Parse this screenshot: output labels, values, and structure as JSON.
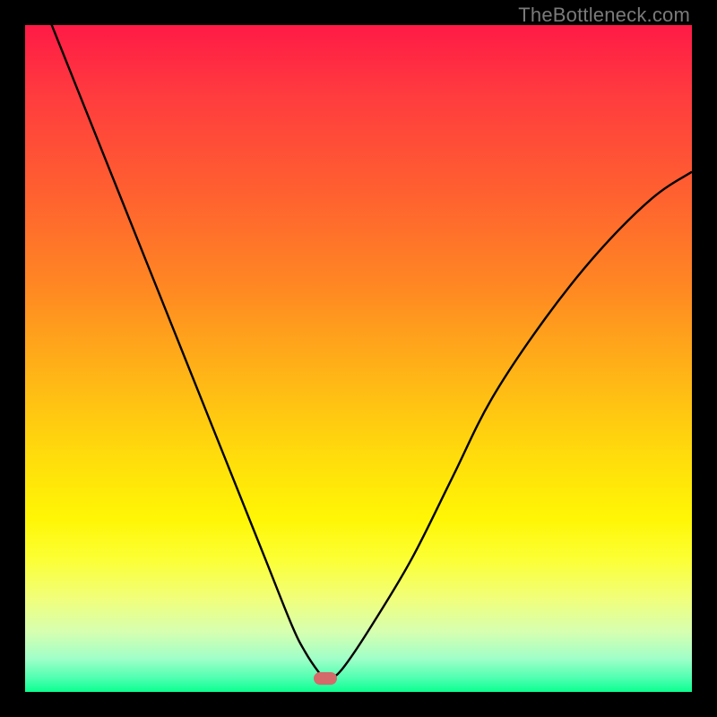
{
  "watermark": "TheBottleneck.com",
  "chart_data": {
    "type": "line",
    "title": "",
    "xlabel": "",
    "ylabel": "",
    "xlim": [
      0,
      100
    ],
    "ylim": [
      0,
      100
    ],
    "grid": false,
    "series": [
      {
        "name": "bottleneck_curve",
        "x": [
          0,
          4,
          8,
          12,
          16,
          20,
          24,
          28,
          32,
          36,
          40,
          42,
          44,
          45,
          46,
          48,
          52,
          58,
          64,
          70,
          78,
          86,
          94,
          100
        ],
        "values": [
          110,
          100,
          90,
          80,
          70,
          60,
          50,
          40,
          30,
          20,
          10,
          6,
          3,
          2,
          2,
          4,
          10,
          20,
          32,
          44,
          56,
          66,
          74,
          78
        ]
      }
    ],
    "annotations": [
      {
        "type": "marker",
        "shape": "pill",
        "x": 45,
        "y": 2,
        "color": "#d46a6a"
      }
    ],
    "background_gradient": {
      "direction": "vertical",
      "stops": [
        {
          "pos": 0.0,
          "color": "#ff1a46"
        },
        {
          "pos": 0.25,
          "color": "#ff6030"
        },
        {
          "pos": 0.52,
          "color": "#ffb317"
        },
        {
          "pos": 0.74,
          "color": "#fff605"
        },
        {
          "pos": 0.91,
          "color": "#d6ffb0"
        },
        {
          "pos": 1.0,
          "color": "#0bff8f"
        }
      ]
    }
  }
}
